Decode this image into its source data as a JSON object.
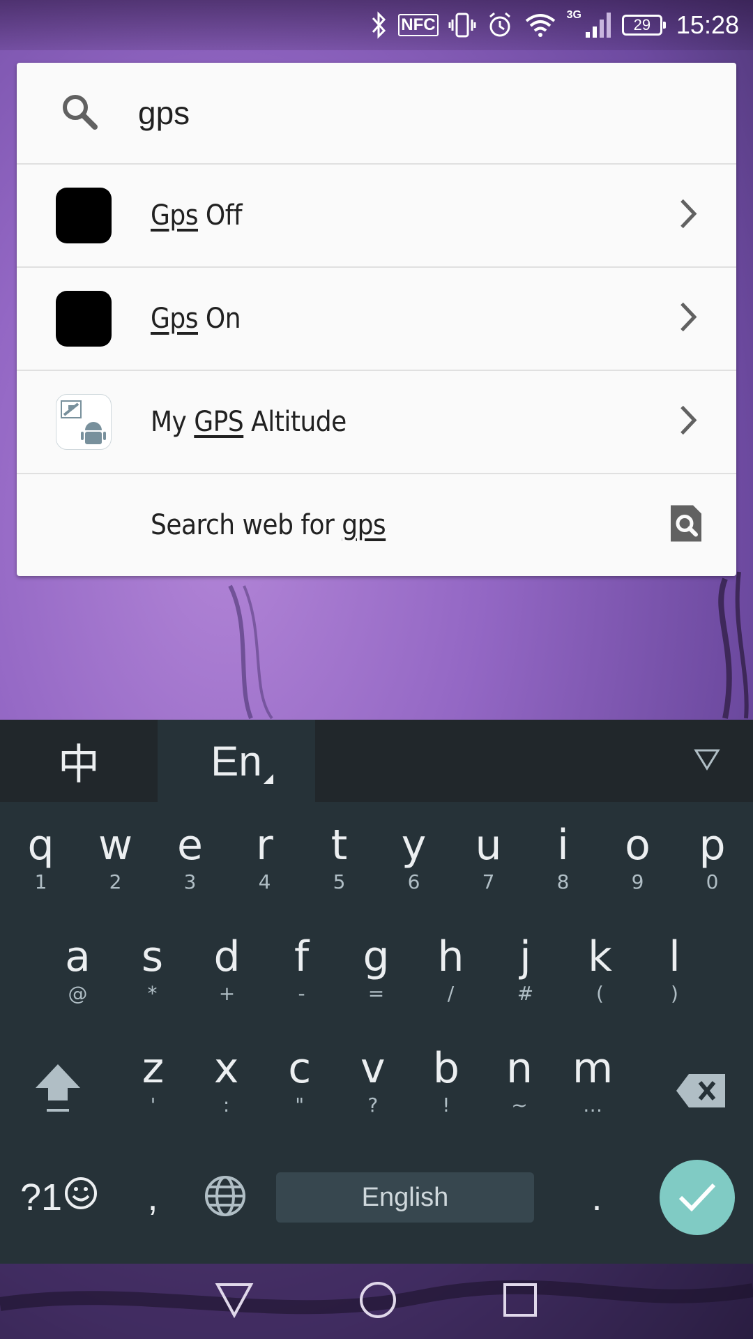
{
  "status_bar": {
    "nfc": "NFC",
    "network": "3G",
    "battery": "29",
    "time": "15:28"
  },
  "search": {
    "query": "gps",
    "results": [
      {
        "prefix": "",
        "match": "Gps",
        "suffix": " Off",
        "icon": "black-app-icon"
      },
      {
        "prefix": "",
        "match": "Gps",
        "suffix": " On",
        "icon": "black-app-icon"
      },
      {
        "prefix": "My ",
        "match": "GPS",
        "suffix": " Altitude",
        "icon": "gps-altitude-app-icon"
      }
    ],
    "web": {
      "prefix": "Search web for ",
      "match": "gps"
    }
  },
  "keyboard": {
    "tabs": {
      "chinese": "中",
      "english": "En"
    },
    "row1": [
      {
        "k": "q",
        "s": "1"
      },
      {
        "k": "w",
        "s": "2"
      },
      {
        "k": "e",
        "s": "3"
      },
      {
        "k": "r",
        "s": "4"
      },
      {
        "k": "t",
        "s": "5"
      },
      {
        "k": "y",
        "s": "6"
      },
      {
        "k": "u",
        "s": "7"
      },
      {
        "k": "i",
        "s": "8"
      },
      {
        "k": "o",
        "s": "9"
      },
      {
        "k": "p",
        "s": "0"
      }
    ],
    "row2": [
      {
        "k": "a",
        "s": "@"
      },
      {
        "k": "s",
        "s": "*"
      },
      {
        "k": "d",
        "s": "+"
      },
      {
        "k": "f",
        "s": "-"
      },
      {
        "k": "g",
        "s": "="
      },
      {
        "k": "h",
        "s": "/"
      },
      {
        "k": "j",
        "s": "#"
      },
      {
        "k": "k",
        "s": "("
      },
      {
        "k": "l",
        "s": ")"
      }
    ],
    "row3": [
      {
        "k": "z",
        "s": "'"
      },
      {
        "k": "x",
        "s": ":"
      },
      {
        "k": "c",
        "s": "\""
      },
      {
        "k": "v",
        "s": "?"
      },
      {
        "k": "b",
        "s": "!"
      },
      {
        "k": "n",
        "s": "~"
      },
      {
        "k": "m",
        "s": "…"
      }
    ],
    "symbols": "?1",
    "comma": ",",
    "space": "English",
    "period": "."
  }
}
